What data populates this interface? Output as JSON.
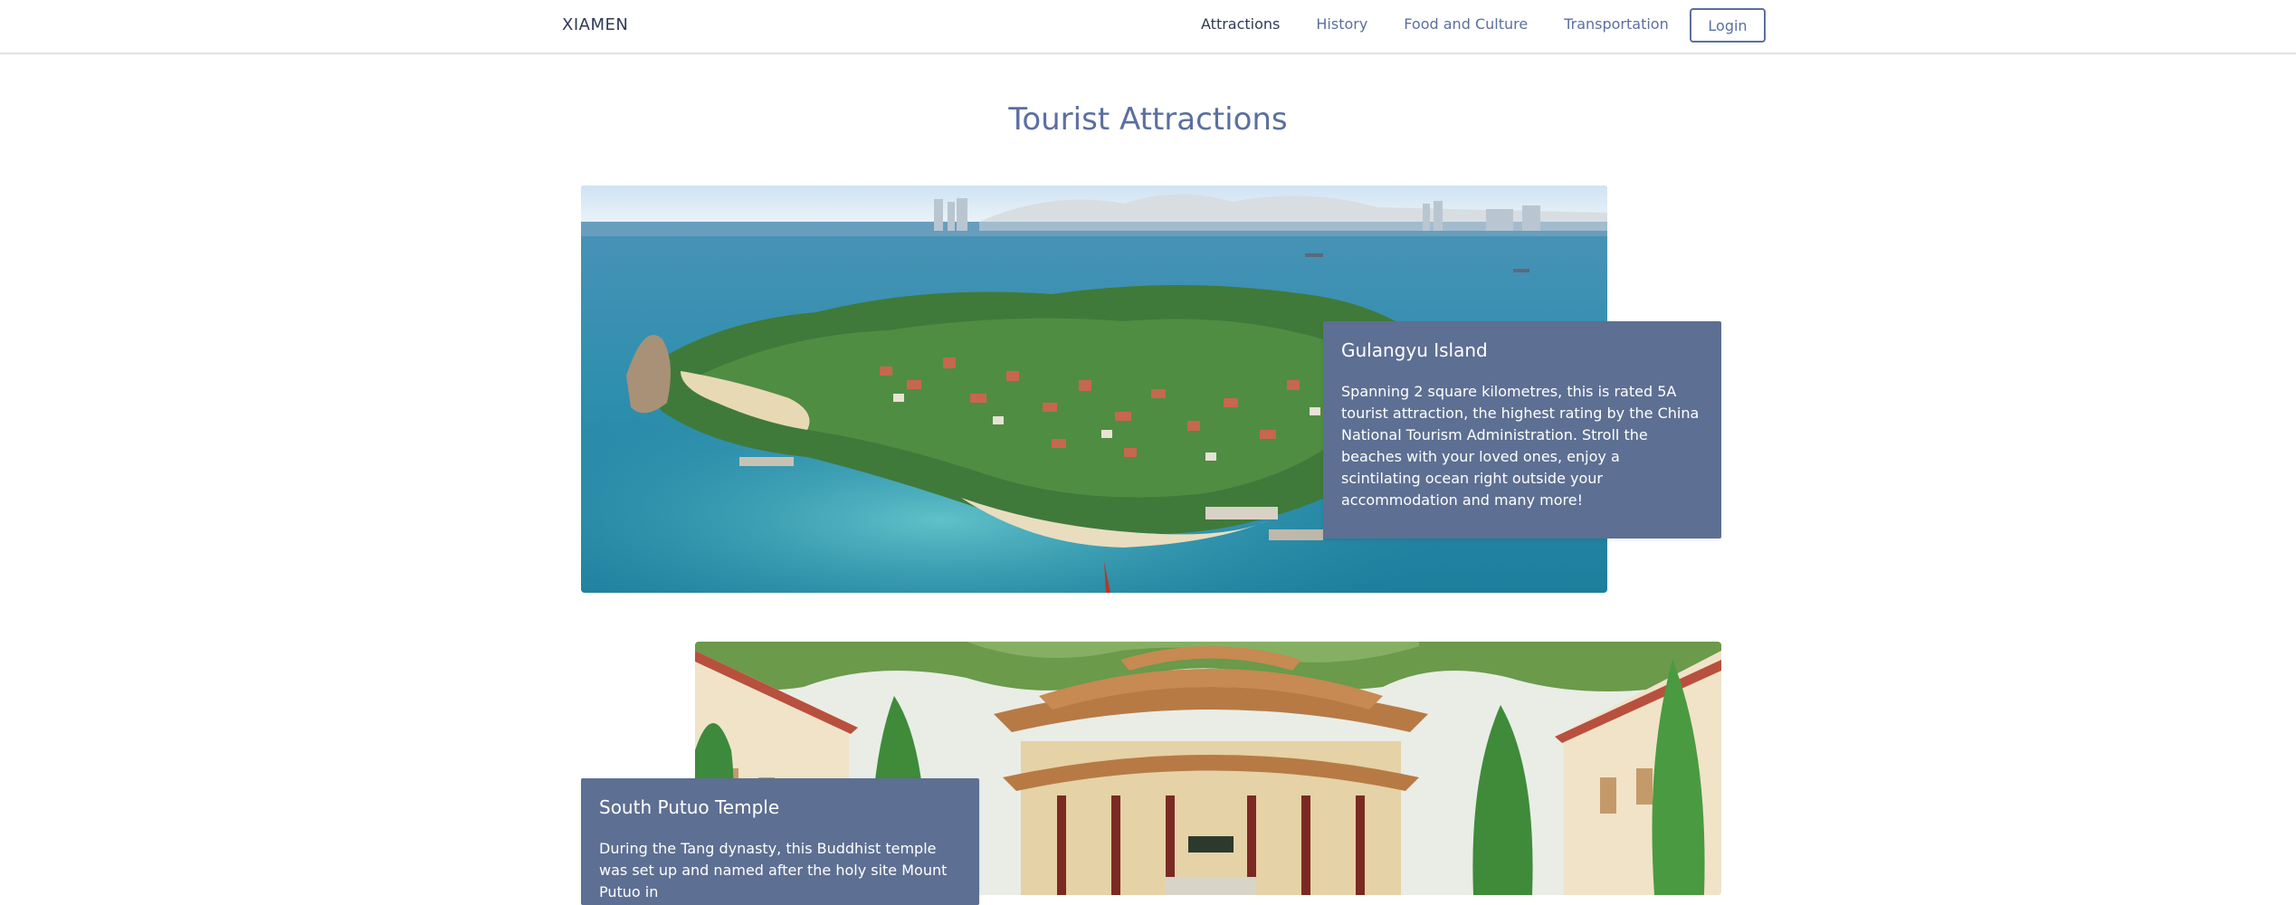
{
  "nav": {
    "brand": "XIAMEN",
    "links": [
      {
        "label": "Attractions"
      },
      {
        "label": "History"
      },
      {
        "label": "Food and Culture"
      },
      {
        "label": "Transportation"
      }
    ],
    "login_label": "Login"
  },
  "page": {
    "title": "Tourist Attractions"
  },
  "attractions": [
    {
      "title": "Gulangyu Island",
      "description": "Spanning 2 square kilometres, this is rated 5A tourist attraction, the highest rating by the China National Tourism Administration. Stroll the beaches with your loved ones, enjoy a scintilating ocean right outside your accommodation and many more!"
    },
    {
      "title": "South Putuo Temple",
      "description": "During the Tang dynasty, this Buddhist temple was set up and named after the holy site Mount Putuo in"
    }
  ],
  "colors": {
    "accent": "#5b6fa0",
    "info_box": "#5d6f92",
    "text_dark": "#2f3a55"
  }
}
